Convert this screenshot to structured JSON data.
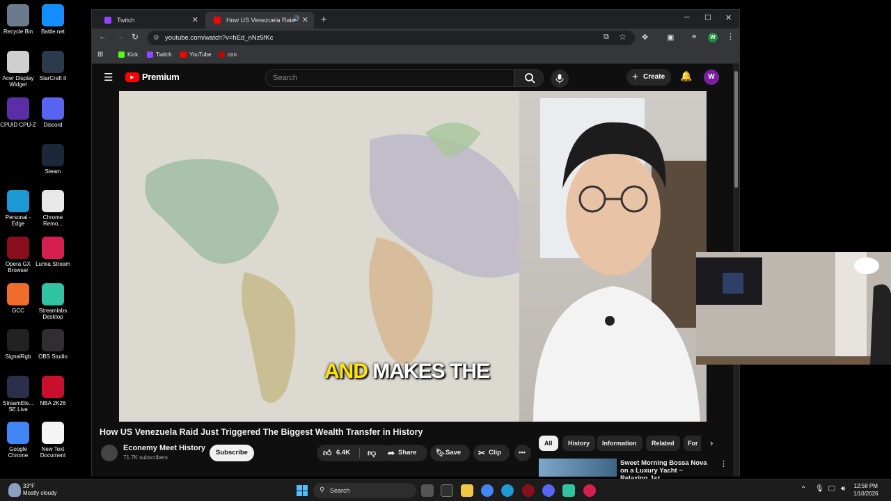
{
  "desktop": {
    "icons": [
      {
        "label": "Recycle Bin",
        "color": "#6b7a8c"
      },
      {
        "label": "Battle.net",
        "color": "#148eff"
      },
      {
        "label": "Acer Display Widget",
        "color": "#cfcfcf"
      },
      {
        "label": "StarCraft II",
        "color": "#2b3a4d"
      },
      {
        "label": "CPUID CPU-Z",
        "color": "#5a2ea6"
      },
      {
        "label": "Discord",
        "color": "#5865f2"
      },
      {
        "label": "Steam",
        "color": "#1b2838"
      },
      {
        "label": "Personal - Edge",
        "color": "#1d9ad6"
      },
      {
        "label": "Chrome Remo...",
        "color": "#e8e8e8"
      },
      {
        "label": "Opera GX Browser",
        "color": "#8a0f1e"
      },
      {
        "label": "Lumia Stream",
        "color": "#d61f4e"
      },
      {
        "label": "GCC",
        "color": "#ef6c2a"
      },
      {
        "label": "Streamlabs Desktop",
        "color": "#31c3a2"
      },
      {
        "label": "SignalRgb",
        "color": "#222222"
      },
      {
        "label": "OBS Studio",
        "color": "#302e31"
      },
      {
        "label": "StreamEle... SE.Live",
        "color": "#2a2f4a"
      },
      {
        "label": "NBA 2K26",
        "color": "#c8102e"
      },
      {
        "label": "Google Chrome",
        "color": "#4285f4"
      },
      {
        "label": "New Text Document",
        "color": "#f4f4f4"
      }
    ]
  },
  "browser": {
    "tabs": [
      {
        "label": "Twitch",
        "color": "#9146ff"
      },
      {
        "label": "How US Venezuela Raid Ju",
        "color": "#ff0000"
      }
    ],
    "url": "youtube.com/watch?v=hEd_nNz5fKc",
    "bookmarks": [
      {
        "label": "Kick",
        "color": "#53fc18"
      },
      {
        "label": "Twitch",
        "color": "#9146ff"
      },
      {
        "label": "YouTube",
        "color": "#ff0000"
      },
      {
        "label": "cnn",
        "color": "#cc0000"
      }
    ],
    "profile_initial": "W"
  },
  "youtube": {
    "logo_text": "Premium",
    "search_placeholder": "Search",
    "create_label": "Create",
    "avatar_initial": "W",
    "caption_highlight": "AND",
    "caption_rest": "MAKES THE",
    "video_title": "How US Venezuela Raid Just Triggered The Biggest Wealth Transfer in History",
    "channel_name": "Econemy Meet History",
    "subscribers": "71.7K subscribers",
    "subscribe_label": "Subscribe",
    "likes": "6.4K",
    "share_label": "Share",
    "save_label": "Save",
    "clip_label": "Clip",
    "chips": [
      "All",
      "History",
      "Information",
      "Related",
      "For"
    ],
    "recommendation_title": "Sweet Morning Bossa Nova on a Luxury Yacht ~ Relaxing Jaz"
  },
  "taskbar": {
    "temperature": "33°F",
    "weather": "Mostly cloudy",
    "search_label": "Search",
    "time": "12:58 PM",
    "date": "1/10/2026"
  }
}
